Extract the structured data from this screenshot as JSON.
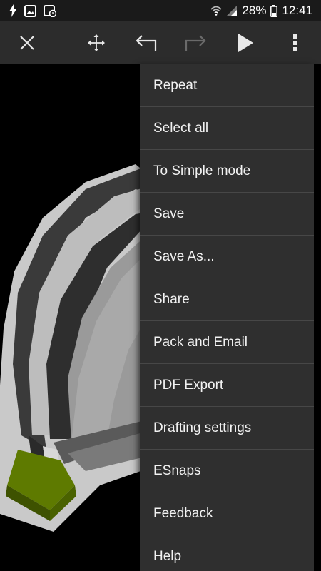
{
  "status_bar": {
    "battery_percent": "28%",
    "time": "12:41"
  },
  "toolbar": {
    "icons": [
      "close-icon",
      "move-icon",
      "undo-icon",
      "redo-icon",
      "play-icon",
      "more-vert-icon"
    ]
  },
  "menu": {
    "items": [
      {
        "label": "Repeat"
      },
      {
        "label": "Select all"
      },
      {
        "label": "To Simple mode"
      },
      {
        "label": "Save"
      },
      {
        "label": "Save As..."
      },
      {
        "label": "Share"
      },
      {
        "label": "Pack and Email"
      },
      {
        "label": "PDF Export"
      },
      {
        "label": "Drafting settings"
      },
      {
        "label": "ESnaps"
      },
      {
        "label": "Feedback"
      },
      {
        "label": "Help"
      }
    ]
  },
  "colors": {
    "toolbar_bg": "#2c2c2c",
    "menu_bg": "#2f2f2f",
    "canvas_bg": "#000000",
    "model_green": "#5e7a00"
  }
}
